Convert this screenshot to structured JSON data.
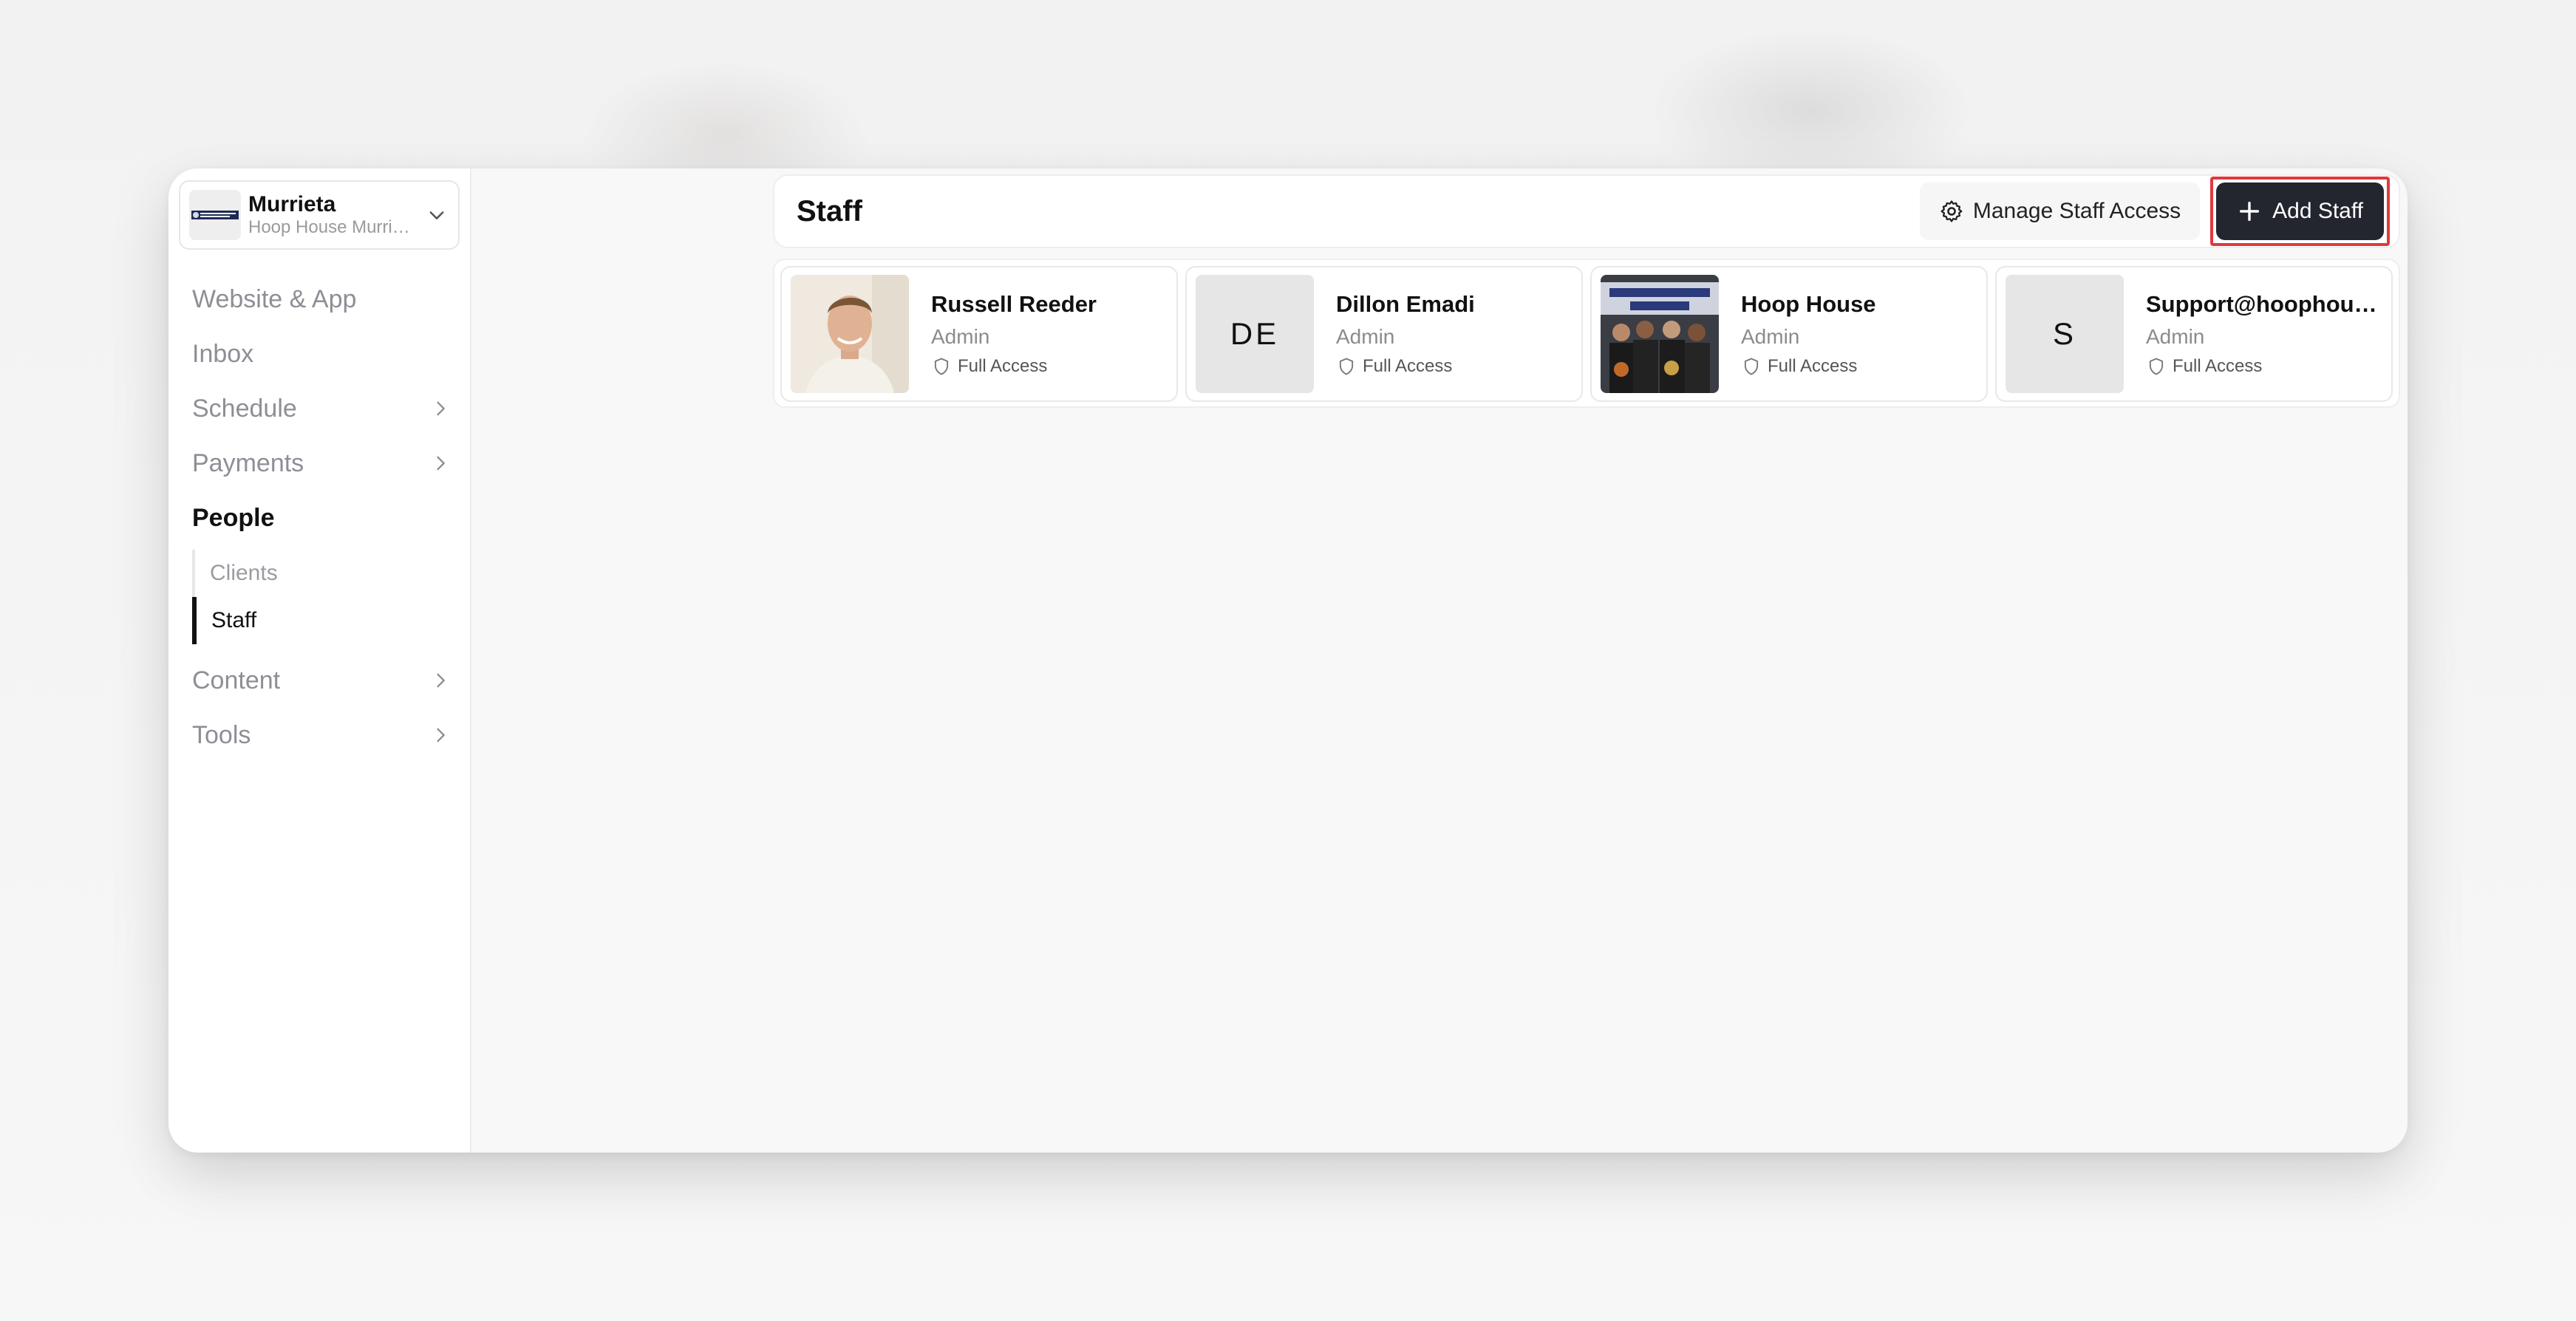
{
  "workspace": {
    "name": "Murrieta",
    "subtitle": "Hoop House Murrieta",
    "logo": "hoop-house-logo"
  },
  "sidebar": {
    "items": [
      {
        "label": "Website & App",
        "chevron": false,
        "active": false
      },
      {
        "label": "Inbox",
        "chevron": false,
        "active": false
      },
      {
        "label": "Schedule",
        "chevron": true,
        "active": false
      },
      {
        "label": "Payments",
        "chevron": true,
        "active": false
      },
      {
        "label": "People",
        "chevron": false,
        "active": true
      },
      {
        "label": "Content",
        "chevron": true,
        "active": false
      },
      {
        "label": "Tools",
        "chevron": true,
        "active": false
      }
    ],
    "people_sub": [
      {
        "label": "Clients",
        "active": false
      },
      {
        "label": "Staff",
        "active": true
      }
    ]
  },
  "header": {
    "title": "Staff",
    "manage_label": "Manage Staff Access",
    "add_label": "Add Staff"
  },
  "staff": [
    {
      "name": "Russell Reeder",
      "role": "Admin",
      "access": "Full Access",
      "avatar": "photo"
    },
    {
      "name": "Dillon Emadi",
      "role": "Admin",
      "access": "Full Access",
      "avatar": "DE"
    },
    {
      "name": "Hoop House",
      "role": "Admin",
      "access": "Full Access",
      "avatar": "photo-group"
    },
    {
      "name": "Support@hoophouse...",
      "role": "Admin",
      "access": "Full Access",
      "avatar": "S"
    }
  ],
  "colors": {
    "primary_button": "#23262e",
    "highlight_border": "#e0393e"
  }
}
